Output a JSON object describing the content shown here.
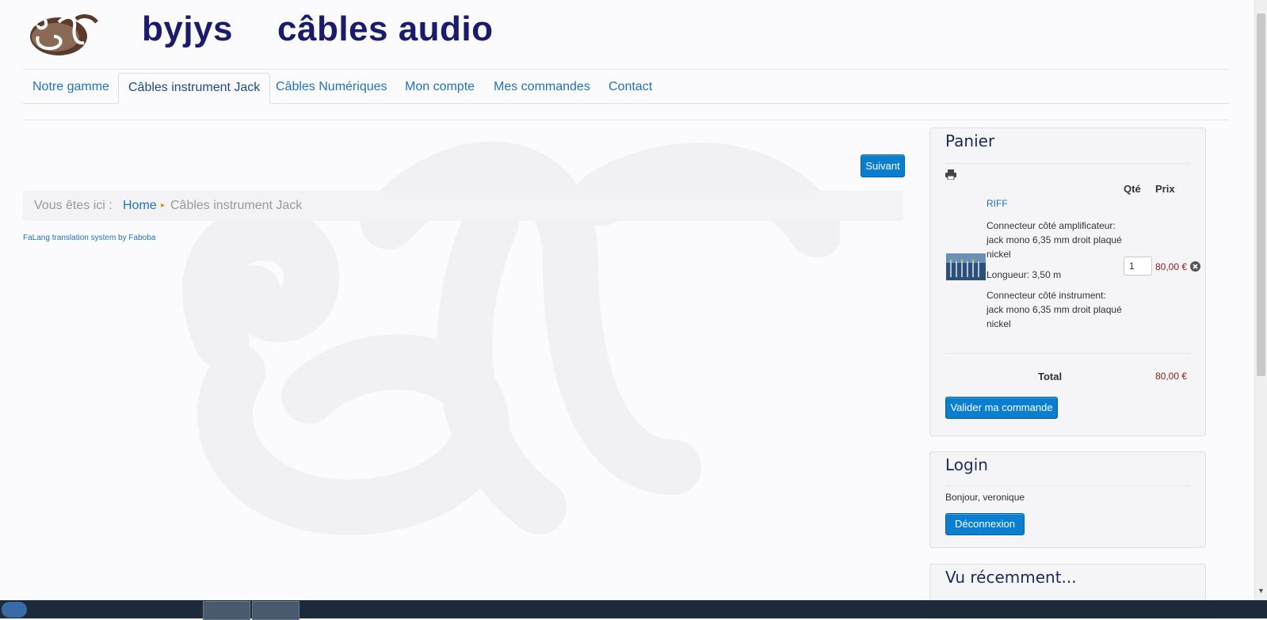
{
  "header": {
    "brand_name": "byjys",
    "brand_tagline": "câbles audio"
  },
  "nav": {
    "items": [
      {
        "label": "Notre gamme",
        "active": false
      },
      {
        "label": "Câbles instrument Jack",
        "active": true
      },
      {
        "label": "Câbles Numériques",
        "active": false
      },
      {
        "label": "Mon compte",
        "active": false
      },
      {
        "label": "Mes commandes",
        "active": false
      },
      {
        "label": "Contact",
        "active": false
      }
    ]
  },
  "main": {
    "next_button": "Suivant",
    "breadcrumb": {
      "label": "Vous êtes ici :",
      "home": "Home",
      "current": "Câbles instrument Jack"
    },
    "falang_credit": "FaLang translation system by Faboba"
  },
  "cart": {
    "title": "Panier",
    "col_qty": "Qté",
    "col_price": "Prix",
    "product": {
      "name": "RIFF",
      "option_1": "Connecteur côté amplificateur: jack mono 6,35 mm droit plaqué nickel",
      "option_2": "Longueur: 3,50 m",
      "option_3": "Connecteur côté instrument: jack mono 6,35 mm droit plaqué nickel",
      "quantity": "1",
      "price": "80,00 €"
    },
    "total_label": "Total",
    "total_value": "80,00 €",
    "validate_button": "Valider ma commande"
  },
  "login": {
    "title": "Login",
    "greeting": "Bonjour, veronique",
    "logout_button": "Déconnexion"
  },
  "recent": {
    "title": "Vu récemment..."
  },
  "colors": {
    "brand": "#1b1b6e",
    "link": "#1e73be",
    "button": "#0a7fd0",
    "price": "#8b1a1a"
  }
}
